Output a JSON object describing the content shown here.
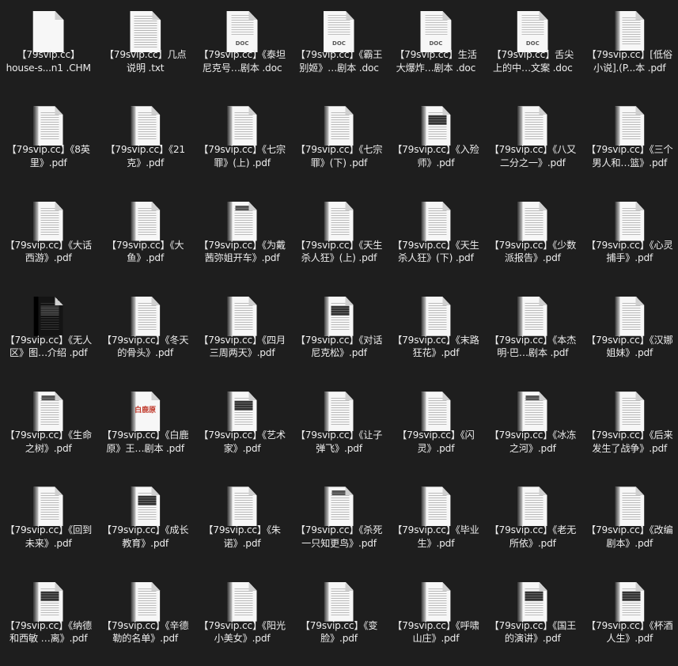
{
  "files": [
    {
      "name": "【79svip.cc】\nhouse-s...n1 .CHM",
      "thumb": "generic"
    },
    {
      "name": "【79svip.cc】几点\n说明 .txt",
      "thumb": "txt"
    },
    {
      "name": "【79svip.cc】《泰坦\n尼克号…剧本 .doc",
      "thumb": "doc",
      "thumb_text": "DOC"
    },
    {
      "name": "【79svip.cc】《霸王\n别姬》…剧本 .doc",
      "thumb": "doc",
      "thumb_text": "DOC"
    },
    {
      "name": "【79svip.cc】生活\n大爆炸…剧本 .doc",
      "thumb": "doc",
      "thumb_text": "DOC"
    },
    {
      "name": "【79svip.cc】舌尖\n上的中…文案 .doc",
      "thumb": "doc",
      "thumb_text": "DOC"
    },
    {
      "name": "【79svip.cc】[低俗\n小说].(P...本 .pdf",
      "thumb": "pdf"
    },
    {
      "name": "【79svip.cc】《8英\n里》.pdf",
      "thumb": "pdf"
    },
    {
      "name": "【79svip.cc】《21\n克》.pdf",
      "thumb": "pdf"
    },
    {
      "name": "【79svip.cc】《七宗\n罪》(上) .pdf",
      "thumb": "pdf"
    },
    {
      "name": "【79svip.cc】《七宗\n罪》(下) .pdf",
      "thumb": "pdf"
    },
    {
      "name": "【79svip.cc】《入殓\n师》.pdf",
      "thumb": "pdf-img"
    },
    {
      "name": "【79svip.cc】《八又\n二分之一》.pdf",
      "thumb": "pdf"
    },
    {
      "name": "【79svip.cc】《三个\n男人和…篮》.pdf",
      "thumb": "pdf"
    },
    {
      "name": "【79svip.cc】《大话\n西游》.pdf",
      "thumb": "pdf"
    },
    {
      "name": "【79svip.cc】《大\n鱼》.pdf",
      "thumb": "pdf"
    },
    {
      "name": "【79svip.cc】《为戴\n茜弥姐开车》.pdf",
      "thumb": "pdf-hdr"
    },
    {
      "name": "【79svip.cc】《天生\n杀人狂》(上) .pdf",
      "thumb": "pdf"
    },
    {
      "name": "【79svip.cc】《天生\n杀人狂》(下) .pdf",
      "thumb": "pdf"
    },
    {
      "name": "【79svip.cc】《少数\n派报告》.pdf",
      "thumb": "pdf"
    },
    {
      "name": "【79svip.cc】《心灵\n捕手》.pdf",
      "thumb": "pdf"
    },
    {
      "name": "【79svip.cc】《无人\n区》图…介绍 .pdf",
      "thumb": "pdf-dark"
    },
    {
      "name": "【79svip.cc】《冬天\n的骨头》.pdf",
      "thumb": "pdf"
    },
    {
      "name": "【79svip.cc】《四月\n三周两天》.pdf",
      "thumb": "pdf"
    },
    {
      "name": "【79svip.cc】《对话\n尼克松》.pdf",
      "thumb": "pdf-img"
    },
    {
      "name": "【79svip.cc】《末路\n狂花》.pdf",
      "thumb": "pdf"
    },
    {
      "name": "【79svip.cc】《本杰\n明·巴…剧本 .pdf",
      "thumb": "pdf"
    },
    {
      "name": "【79svip.cc】《汉娜\n姐妹》.pdf",
      "thumb": "pdf"
    },
    {
      "name": "【79svip.cc】《生命\n之树》.pdf",
      "thumb": "pdf-hdr"
    },
    {
      "name": "【79svip.cc】《白鹿\n原》王…剧本 .pdf",
      "thumb": "pdf-red",
      "thumb_text": "白鹿原"
    },
    {
      "name": "【79svip.cc】《艺术\n家》.pdf",
      "thumb": "pdf-img"
    },
    {
      "name": "【79svip.cc】《让子\n弹飞》.pdf",
      "thumb": "pdf"
    },
    {
      "name": "【79svip.cc】《闪\n灵》.pdf",
      "thumb": "pdf"
    },
    {
      "name": "【79svip.cc】《冰冻\n之河》.pdf",
      "thumb": "pdf-hdr"
    },
    {
      "name": "【79svip.cc】《后来\n发生了战争》.pdf",
      "thumb": "pdf"
    },
    {
      "name": "【79svip.cc】《回到\n未来》.pdf",
      "thumb": "pdf"
    },
    {
      "name": "【79svip.cc】《成长\n教育》.pdf",
      "thumb": "pdf-img"
    },
    {
      "name": "【79svip.cc】《朱\n诺》.pdf",
      "thumb": "pdf"
    },
    {
      "name": "【79svip.cc】《杀死\n一只知更鸟》.pdf",
      "thumb": "pdf-hdr"
    },
    {
      "name": "【79svip.cc】《毕业\n生》.pdf",
      "thumb": "pdf"
    },
    {
      "name": "【79svip.cc】《老无\n所依》.pdf",
      "thumb": "pdf"
    },
    {
      "name": "【79svip.cc】《改编\n剧本》.pdf",
      "thumb": "pdf"
    },
    {
      "name": "【79svip.cc】《纳德\n和西敏 …离》.pdf",
      "thumb": "pdf-img"
    },
    {
      "name": "【79svip.cc】《辛德\n勒的名单》.pdf",
      "thumb": "pdf"
    },
    {
      "name": "【79svip.cc】《阳光\n小美女》.pdf",
      "thumb": "pdf"
    },
    {
      "name": "【79svip.cc】《变\n脸》.pdf",
      "thumb": "pdf"
    },
    {
      "name": "【79svip.cc】《呼啸\n山庄》.pdf",
      "thumb": "pdf"
    },
    {
      "name": "【79svip.cc】《国王\n的演讲》.pdf",
      "thumb": "pdf-img"
    },
    {
      "name": "【79svip.cc】《杯酒\n人生》.pdf",
      "thumb": "pdf-img"
    }
  ]
}
